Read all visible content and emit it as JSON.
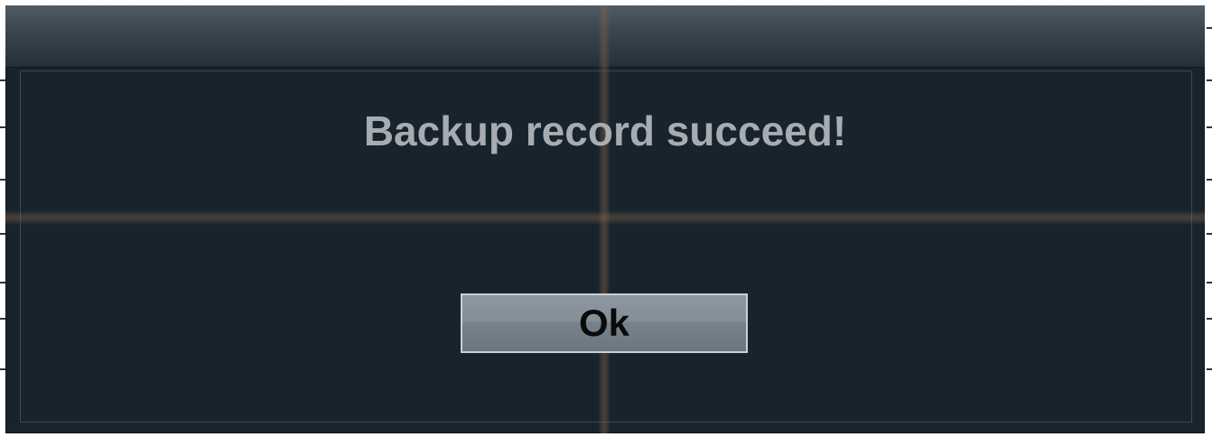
{
  "dialog": {
    "message": "Backup record succeed!",
    "ok_label": "Ok"
  },
  "colors": {
    "background": "#17232d",
    "titlebar": "#3a4650",
    "message_text": "#a6acb1",
    "button_face": "#858f99",
    "button_text": "#0a0a0a"
  }
}
